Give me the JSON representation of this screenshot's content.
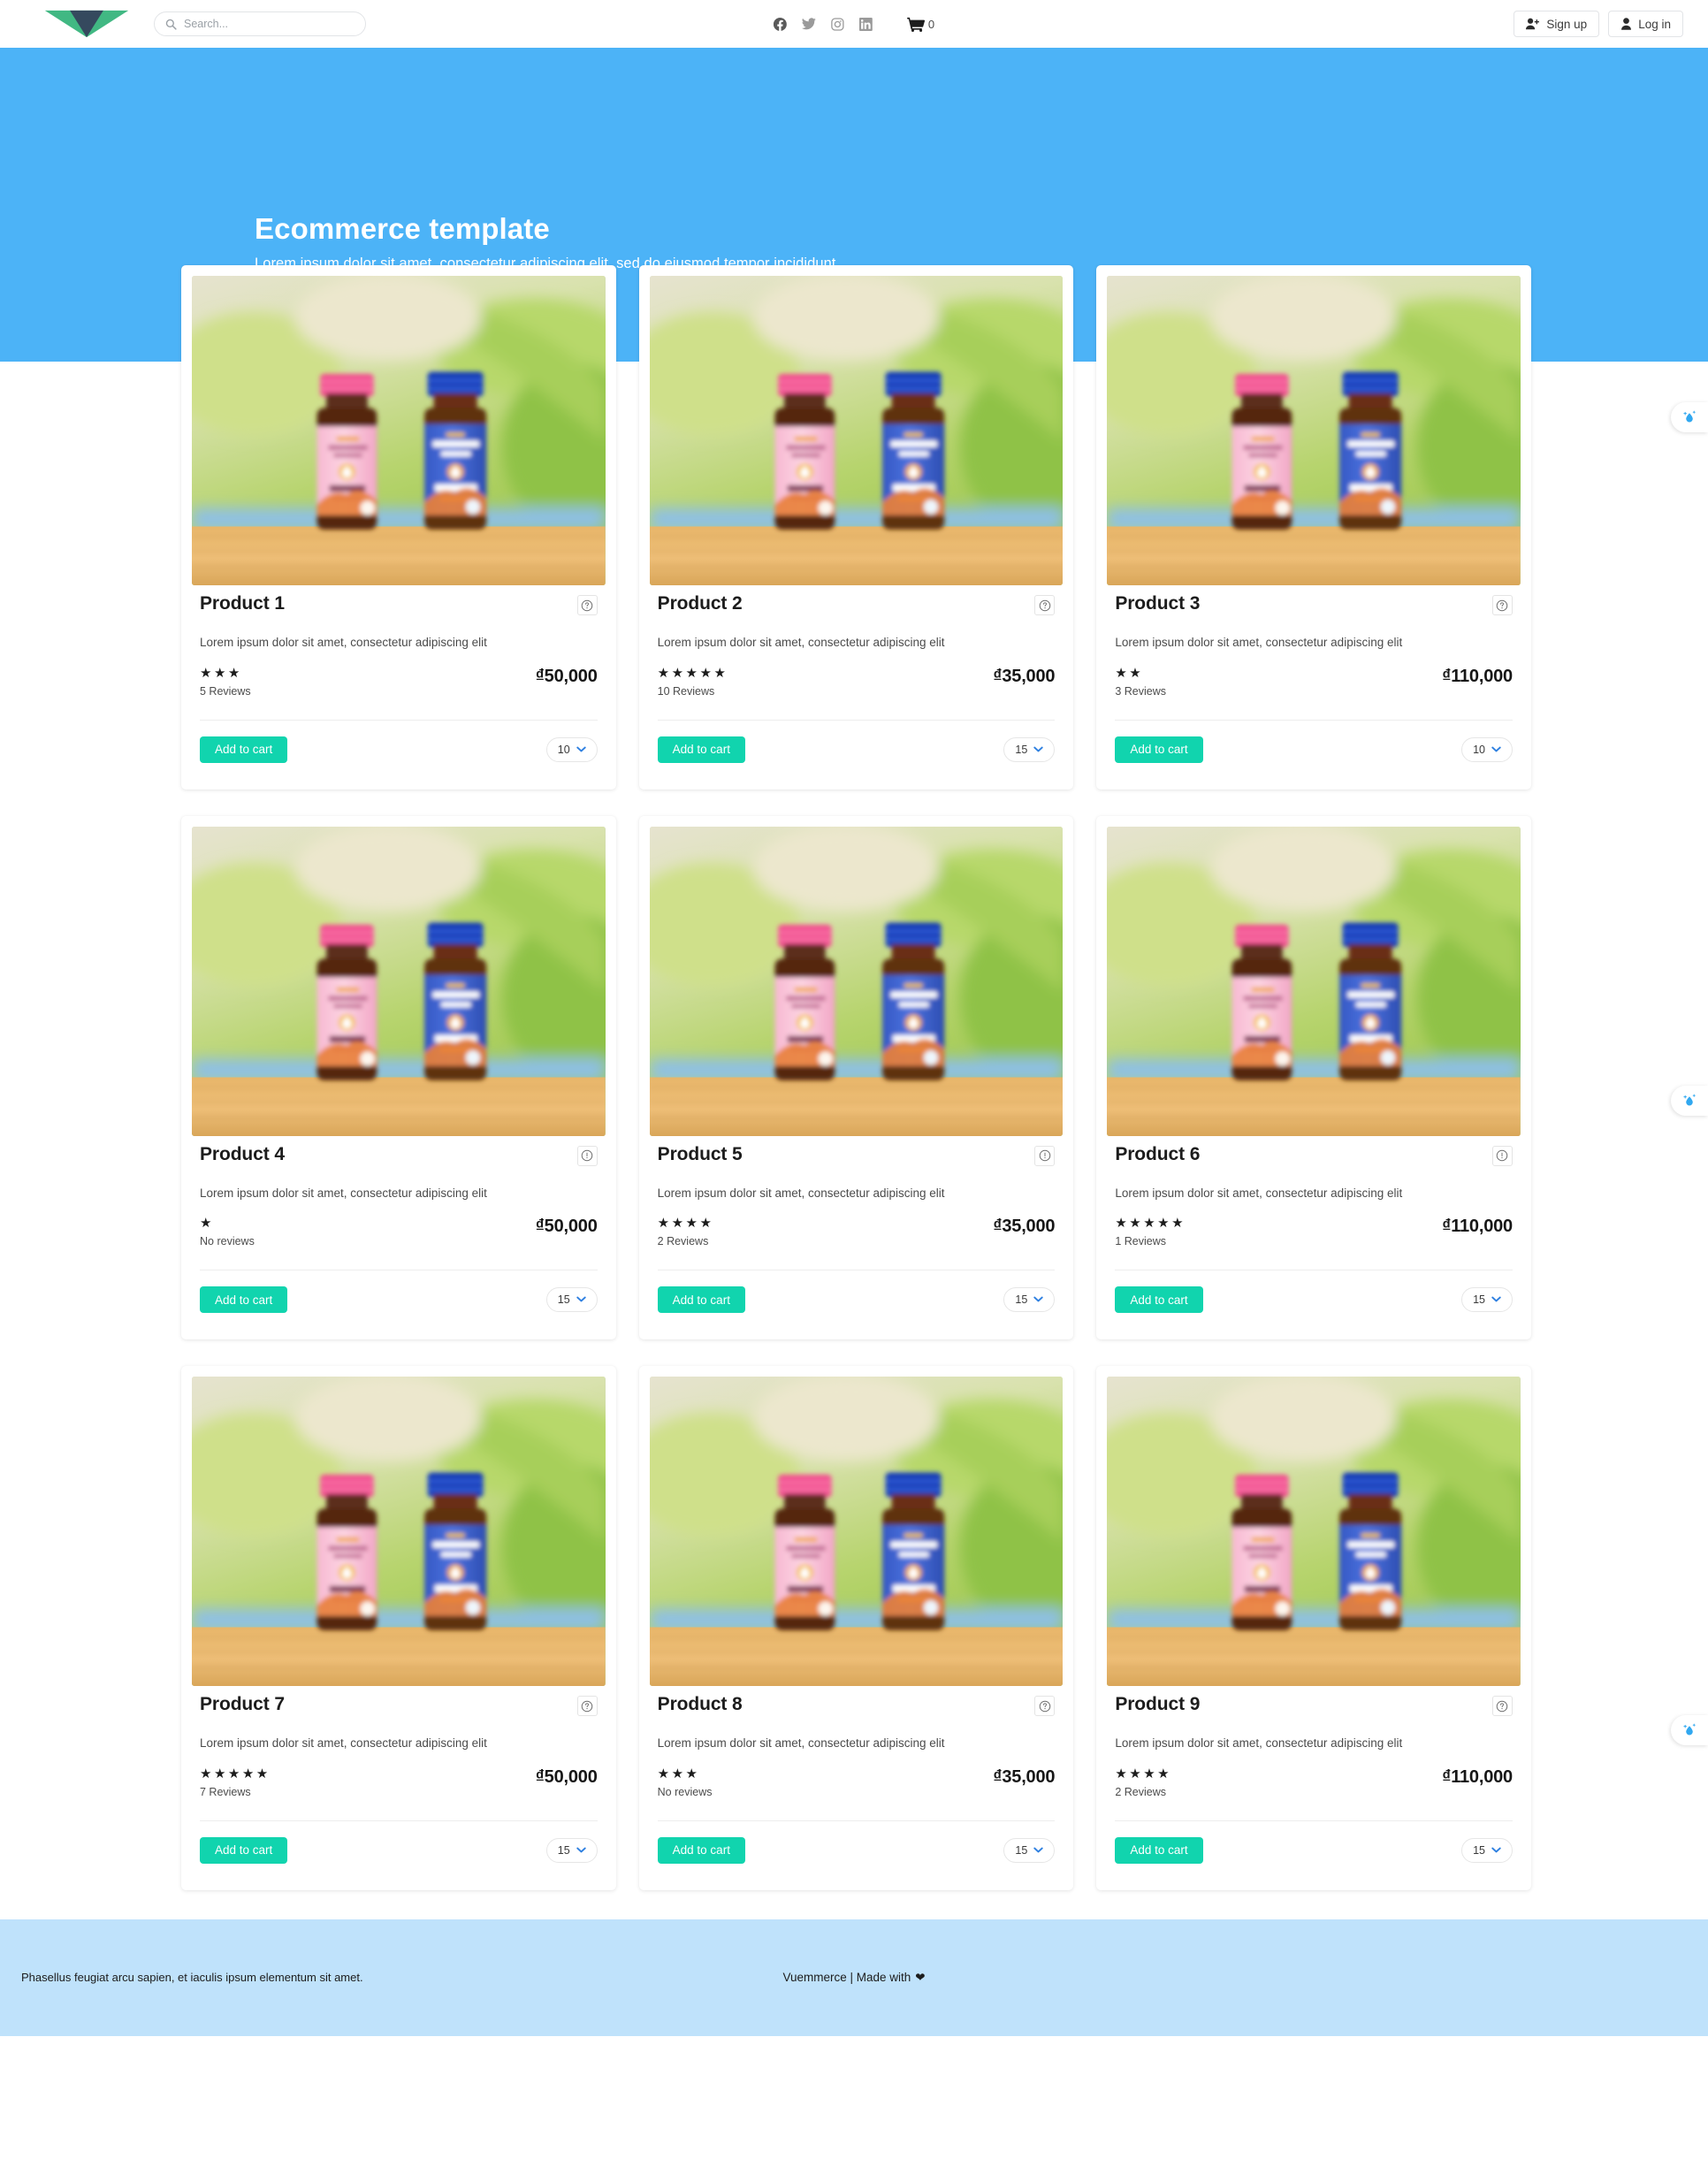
{
  "header": {
    "logo_name": "vue-logo",
    "search": {
      "placeholder": "Search...",
      "value": ""
    },
    "social": [
      {
        "name": "facebook-icon",
        "label": "Facebook"
      },
      {
        "name": "twitter-icon",
        "label": "Twitter"
      },
      {
        "name": "instagram-icon",
        "label": "Instagram"
      },
      {
        "name": "linkedin-icon",
        "label": "LinkedIn"
      }
    ],
    "cart": {
      "icon": "shopping-cart-icon",
      "count": "0"
    },
    "signup_label": "Sign up",
    "login_label": "Log in"
  },
  "hero": {
    "title": "Ecommerce template",
    "subtitle": "Lorem ipsum dolor sit amet, consectetur adipiscing elit, sed do eiusmod tempor incididunt",
    "bg_color": "#4cb3f7"
  },
  "products": [
    {
      "title": "Product 1",
      "description": "Lorem ipsum dolor sit amet, consectetur adipiscing elit",
      "stars": "★★★",
      "star_count": 3,
      "reviews": "5 Reviews",
      "price": "₫50,000",
      "qty": "10",
      "add_label": "Add to cart",
      "info_icon": "help-circle-icon"
    },
    {
      "title": "Product 2",
      "description": "Lorem ipsum dolor sit amet, consectetur adipiscing elit",
      "stars": "★★★★★",
      "star_count": 5,
      "reviews": "10 Reviews",
      "price": "₫35,000",
      "qty": "15",
      "add_label": "Add to cart",
      "info_icon": "help-circle-icon"
    },
    {
      "title": "Product 3",
      "description": "Lorem ipsum dolor sit amet, consectetur adipiscing elit",
      "stars": "★★",
      "star_count": 2,
      "reviews": "3 Reviews",
      "price": "₫110,000",
      "qty": "10",
      "add_label": "Add to cart",
      "info_icon": "help-circle-icon"
    },
    {
      "title": "Product 4",
      "description": "Lorem ipsum dolor sit amet, consectetur adipiscing elit",
      "stars": "★",
      "star_count": 1,
      "reviews": "No reviews",
      "price": "₫50,000",
      "qty": "15",
      "add_label": "Add to cart",
      "info_icon": "alert-circle-icon"
    },
    {
      "title": "Product 5",
      "description": "Lorem ipsum dolor sit amet, consectetur adipiscing elit",
      "stars": "★★★★",
      "star_count": 4,
      "reviews": "2 Reviews",
      "price": "₫35,000",
      "qty": "15",
      "add_label": "Add to cart",
      "info_icon": "alert-circle-icon"
    },
    {
      "title": "Product 6",
      "description": "Lorem ipsum dolor sit amet, consectetur adipiscing elit",
      "stars": "★★★★★",
      "star_count": 5,
      "reviews": "1 Reviews",
      "price": "₫110,000",
      "qty": "15",
      "add_label": "Add to cart",
      "info_icon": "alert-circle-icon"
    },
    {
      "title": "Product 7",
      "description": "Lorem ipsum dolor sit amet, consectetur adipiscing elit",
      "stars": "★★★★★",
      "star_count": 5,
      "reviews": "7 Reviews",
      "price": "₫50,000",
      "qty": "15",
      "add_label": "Add to cart",
      "info_icon": "help-circle-icon"
    },
    {
      "title": "Product 8",
      "description": "Lorem ipsum dolor sit amet, consectetur adipiscing elit",
      "stars": "★★★",
      "star_count": 3,
      "reviews": "No reviews",
      "price": "₫35,000",
      "qty": "15",
      "add_label": "Add to cart",
      "info_icon": "help-circle-icon"
    },
    {
      "title": "Product 9",
      "description": "Lorem ipsum dolor sit amet, consectetur adipiscing elit",
      "stars": "★★★★",
      "star_count": 4,
      "reviews": "2 Reviews",
      "price": "₫110,000",
      "qty": "15",
      "add_label": "Add to cart",
      "info_icon": "help-circle-icon"
    }
  ],
  "side_tabs": [
    {
      "name": "water-drop-tab-1",
      "icon": "water-drop-icon"
    },
    {
      "name": "water-drop-tab-2",
      "icon": "water-drop-icon"
    },
    {
      "name": "water-drop-tab-3",
      "icon": "water-drop-icon"
    }
  ],
  "footer": {
    "left_text": "Phasellus feugiat arcu sapien, et iaculis ipsum elementum sit amet.",
    "center_text": "Vuemmerce | Made with",
    "heart": "❤",
    "bg_color": "#bfe2fb"
  },
  "colors": {
    "accent_teal": "#11d4ae",
    "hero_blue": "#4cb3f7",
    "footer_blue": "#bfe2fb",
    "vue_green": "#41b883",
    "vue_dark": "#35495e"
  }
}
